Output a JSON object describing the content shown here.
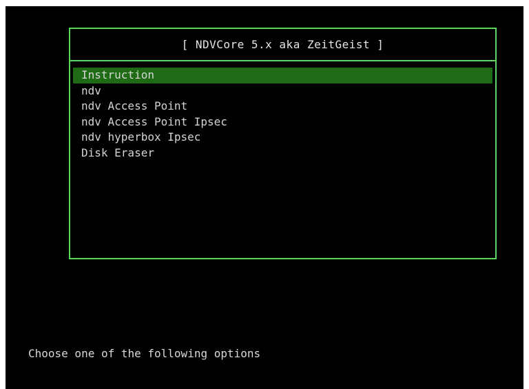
{
  "title": "[ NDVCore 5.x aka ZeitGeist ]",
  "menu": {
    "items": [
      {
        "label": "Instruction",
        "selected": true
      },
      {
        "label": "ndv",
        "selected": false
      },
      {
        "label": "ndv Access Point",
        "selected": false
      },
      {
        "label": "ndv Access Point Ipsec",
        "selected": false
      },
      {
        "label": "ndv hyperbox Ipsec",
        "selected": false
      },
      {
        "label": "Disk Eraser",
        "selected": false
      }
    ]
  },
  "prompt": "Choose one of the following options",
  "colors": {
    "background": "#000000",
    "border": "#59d95a",
    "selection": "#1f6a14",
    "text": "#d4d4d4"
  }
}
